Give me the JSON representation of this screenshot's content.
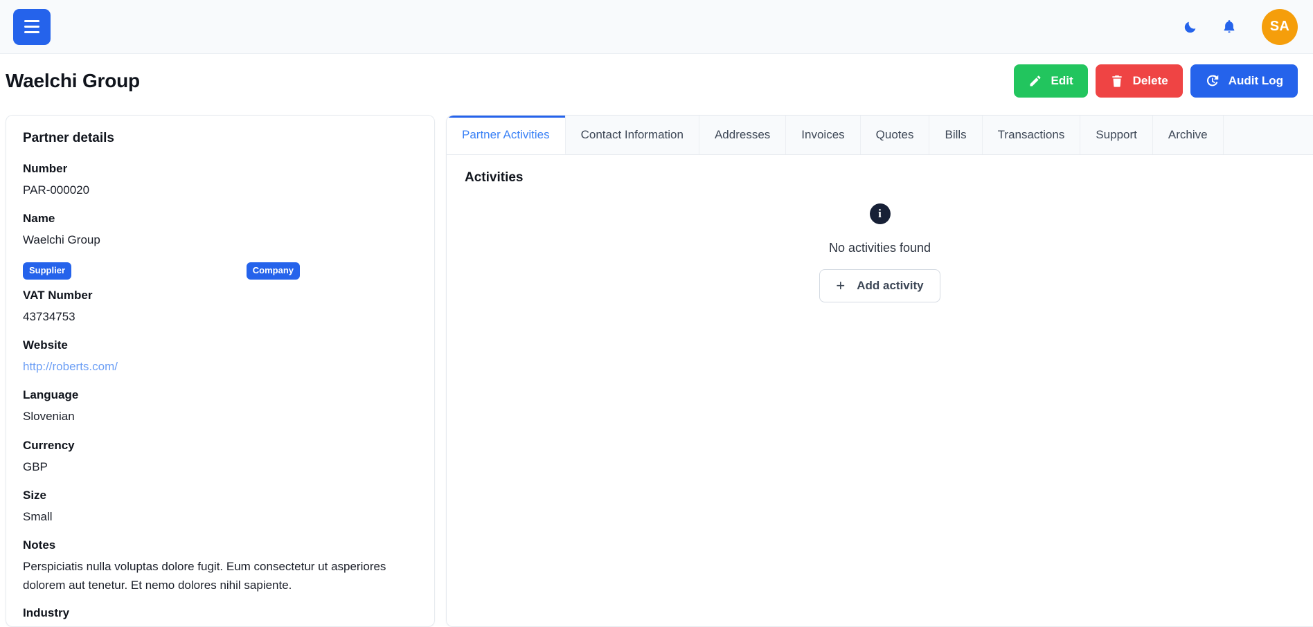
{
  "topbar": {
    "menu_icon": "hamburger-icon",
    "theme_toggle_icon": "moon-icon",
    "notifications_icon": "bell-icon",
    "avatar_initials": "SA",
    "avatar_color": "#f59e0b",
    "accent_color": "#2563eb"
  },
  "header": {
    "title": "Waelchi Group",
    "actions": [
      {
        "label": "Edit",
        "icon": "pencil-icon",
        "color": "#22c55e"
      },
      {
        "label": "Delete",
        "icon": "trash-icon",
        "color": "#ef4444"
      },
      {
        "label": "Audit Log",
        "icon": "history-icon",
        "color": "#2563eb"
      }
    ]
  },
  "details": {
    "title": "Partner details",
    "number_label": "Number",
    "number_value": "PAR-000020",
    "name_label": "Name",
    "name_value": "Waelchi Group",
    "badge_supplier": "Supplier",
    "badge_company": "Company",
    "vat_label": "VAT Number",
    "vat_value": "43734753",
    "website_label": "Website",
    "website_value": "http://roberts.com/",
    "language_label": "Language",
    "language_value": "Slovenian",
    "currency_label": "Currency",
    "currency_value": "GBP",
    "size_label": "Size",
    "size_value": "Small",
    "notes_label": "Notes",
    "notes_value": "Perspiciatis nulla voluptas dolore fugit. Eum consectetur ut asperiores dolorem aut tenetur. Et nemo dolores nihil sapiente.",
    "industry_label": "Industry"
  },
  "tabs": [
    {
      "label": "Partner Activities",
      "active": true
    },
    {
      "label": "Contact Information",
      "active": false
    },
    {
      "label": "Addresses",
      "active": false
    },
    {
      "label": "Invoices",
      "active": false
    },
    {
      "label": "Quotes",
      "active": false
    },
    {
      "label": "Bills",
      "active": false
    },
    {
      "label": "Transactions",
      "active": false
    },
    {
      "label": "Support",
      "active": false
    },
    {
      "label": "Archive",
      "active": false
    }
  ],
  "activities": {
    "section_title": "Activities",
    "info_icon": "info-icon",
    "empty_message": "No activities found",
    "add_button_label": "Add activity",
    "add_button_icon": "plus-icon"
  }
}
